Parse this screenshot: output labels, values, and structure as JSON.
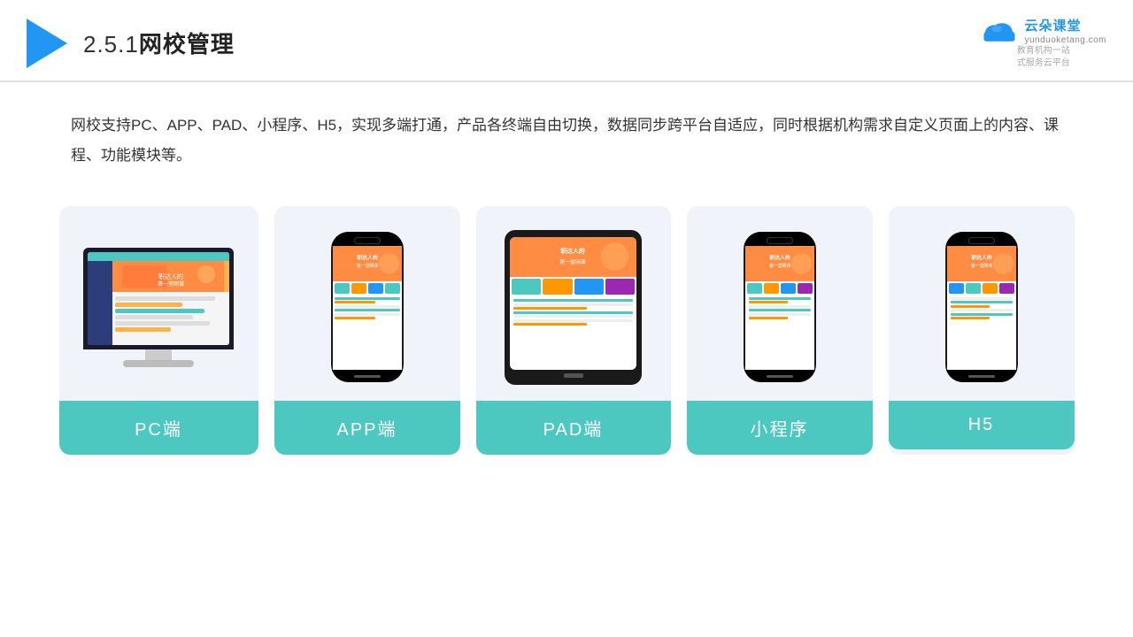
{
  "header": {
    "title": "2.5.1网校管理",
    "title_number": "2.5.1",
    "title_text": "网校管理",
    "brand_name": "云朵课堂",
    "brand_url": "yunduoketang.com",
    "brand_tagline": "教育机构一站\n式服务云平台"
  },
  "description": {
    "text": "网校支持PC、APP、PAD、小程序、H5，实现多端打通，产品各终端自由切换，数据同步跨平台自适应，同时根据机构需求自定义页面上的内容、课程、功能模块等。"
  },
  "cards": [
    {
      "id": "pc",
      "label": "PC端"
    },
    {
      "id": "app",
      "label": "APP端"
    },
    {
      "id": "pad",
      "label": "PAD端"
    },
    {
      "id": "miniprogram",
      "label": "小程序"
    },
    {
      "id": "h5",
      "label": "H5"
    }
  ],
  "colors": {
    "teal": "#4dc8c0",
    "card_bg": "#eef2f9",
    "header_border": "#e0e0e0"
  }
}
